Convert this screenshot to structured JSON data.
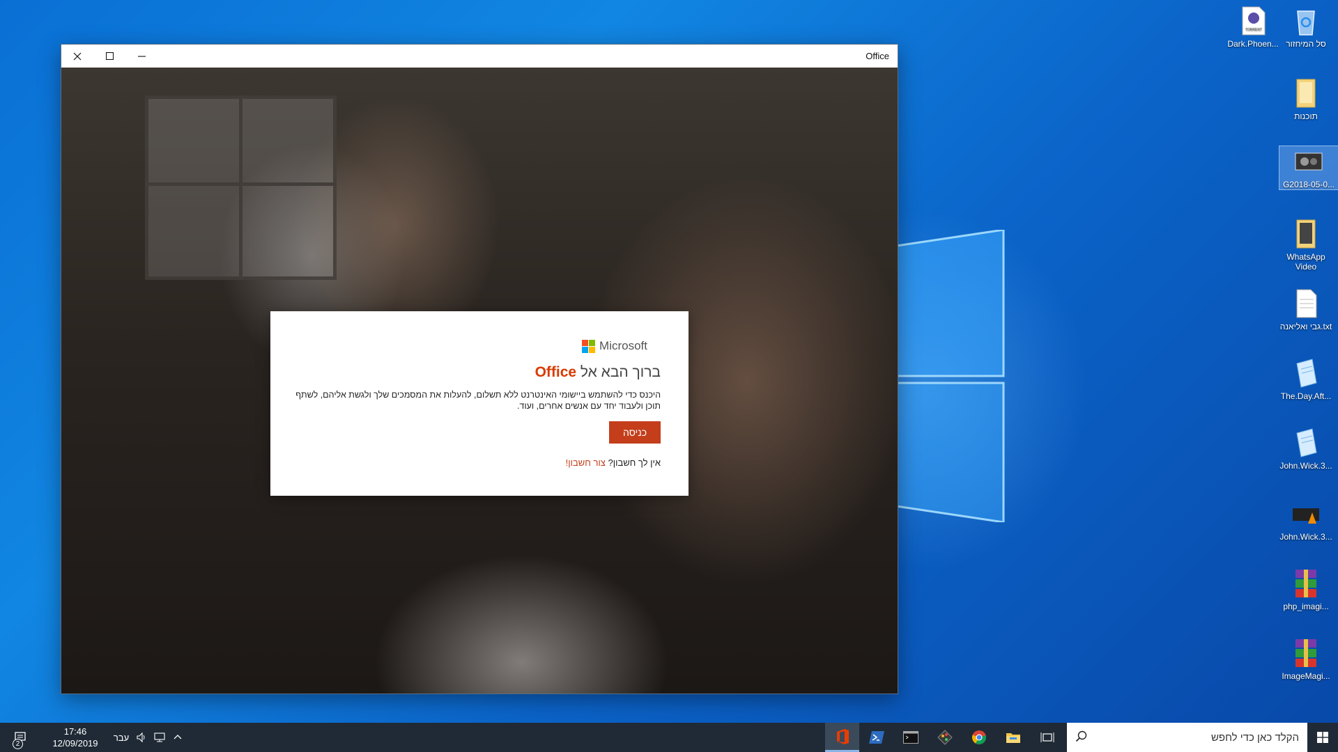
{
  "window": {
    "title": "Office",
    "close_icon": "close-icon",
    "maximize_icon": "maximize-icon",
    "minimize_icon": "minimize-icon"
  },
  "dialog": {
    "logo_text": "Microsoft",
    "logo_colors": [
      "#f25022",
      "#7fba00",
      "#00a4ef",
      "#ffb900"
    ],
    "title_prefix": "ברוך הבא אל ",
    "title_brand": "Office",
    "description": "היכנס כדי להשתמש ביישומי האינטרנט ללא תשלום, להעלות את המסמכים שלך ולגשת אליהם, לשתף תוכן ולעבוד יחד עם אנשים אחרים, ועוד.",
    "signin_label": "כניסה",
    "no_account_text": "אין לך חשבון? ",
    "create_account_link": "צור חשבון!",
    "accent_color": "#c43e1c"
  },
  "desktop_icons": [
    {
      "label": "סל המיחזור",
      "icon": "recycle-bin-icon"
    },
    {
      "label": "Dark.Phoen...",
      "icon": "torrent-file-icon"
    },
    {
      "label": "תוכנות",
      "icon": "folder-icon"
    },
    {
      "label": "G2018-05-0...",
      "icon": "video-thumbnail-icon"
    },
    {
      "label": "WhatsApp Video",
      "icon": "folder-icon"
    },
    {
      "label": "גבי ואליאנה.txt",
      "icon": "text-file-icon"
    },
    {
      "label": "The.Day.Aft...",
      "icon": "notepad-file-icon"
    },
    {
      "label": "John.Wick.3...",
      "icon": "notepad-file-icon"
    },
    {
      "label": "John.Wick.3...",
      "icon": "vlc-video-icon"
    },
    {
      "label": "php_imagi...",
      "icon": "winrar-archive-icon"
    },
    {
      "label": "ImageMagi...",
      "icon": "winrar-archive-icon"
    }
  ],
  "taskbar": {
    "notifications_count": "2",
    "time": "17:46",
    "date": "12/09/2019",
    "language": "עבר",
    "search_placeholder": "הקלד כאן כדי לחפש",
    "apps": [
      "office-icon",
      "powershell-icon",
      "terminal-icon",
      "git-icon",
      "chrome-icon",
      "file-explorer-icon",
      "task-view-icon"
    ]
  }
}
